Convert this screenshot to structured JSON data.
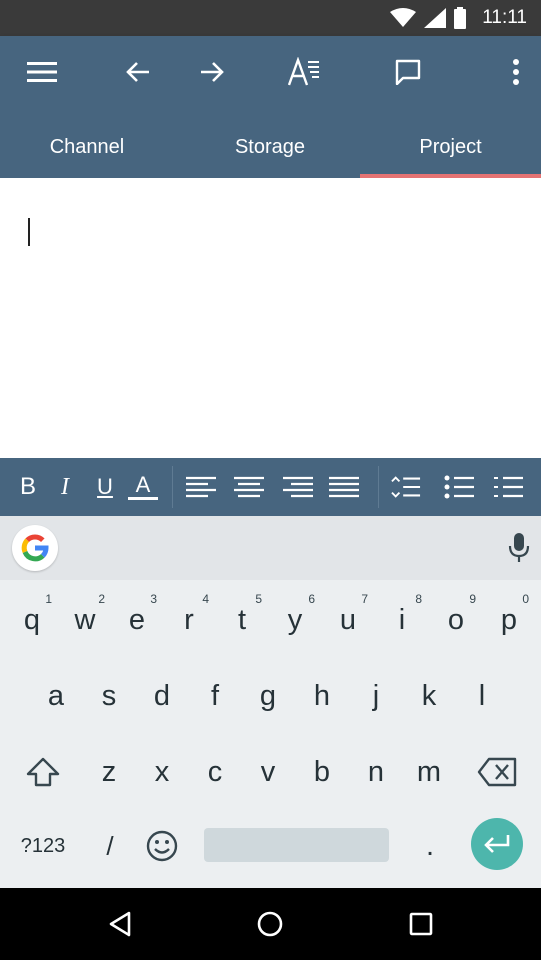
{
  "status_bar": {
    "time": "11:11"
  },
  "toolbar": {
    "menu_icon": "menu-icon",
    "undo_icon": "arrow-left-icon",
    "redo_icon": "arrow-right-icon",
    "text_format_icon": "text-format-icon",
    "comment_icon": "comment-icon",
    "more_icon": "more-vert-icon"
  },
  "tabs": [
    {
      "label": "Channel",
      "active": false
    },
    {
      "label": "Storage",
      "active": false
    },
    {
      "label": "Project",
      "active": true
    }
  ],
  "accent_color": "#e57373",
  "header_color": "#47657f",
  "format_bar": {
    "bold": "B",
    "italic": "I",
    "underline": "U",
    "text_color": "A"
  },
  "keyboard": {
    "row1": [
      {
        "key": "q",
        "hint": "1"
      },
      {
        "key": "w",
        "hint": "2"
      },
      {
        "key": "e",
        "hint": "3"
      },
      {
        "key": "r",
        "hint": "4"
      },
      {
        "key": "t",
        "hint": "5"
      },
      {
        "key": "y",
        "hint": "6"
      },
      {
        "key": "u",
        "hint": "7"
      },
      {
        "key": "i",
        "hint": "8"
      },
      {
        "key": "o",
        "hint": "9"
      },
      {
        "key": "p",
        "hint": "0"
      }
    ],
    "row2": [
      "a",
      "s",
      "d",
      "f",
      "g",
      "h",
      "j",
      "k",
      "l"
    ],
    "row3": [
      "z",
      "x",
      "c",
      "v",
      "b",
      "n",
      "m"
    ],
    "symbols_label": "?123",
    "slash_label": "/",
    "period_label": ".",
    "enter_color": "#4db6ac"
  }
}
